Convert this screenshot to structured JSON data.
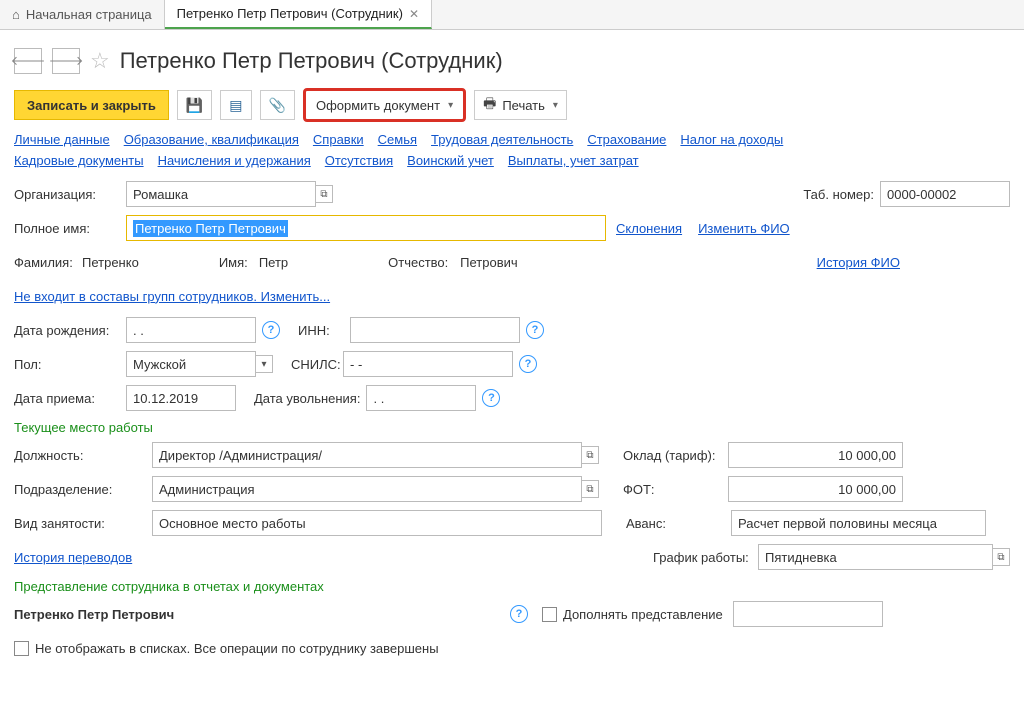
{
  "tabs": {
    "home": "Начальная страница",
    "current": "Петренко Петр Петрович (Сотрудник)"
  },
  "title": "Петренко Петр Петрович (Сотрудник)",
  "toolbar": {
    "save_close": "Записать и закрыть",
    "create_doc": "Оформить документ",
    "print": "Печать"
  },
  "nav1": {
    "personal": "Личные данные",
    "education": "Образование, квалификация",
    "references": "Справки",
    "family": "Семья",
    "labor": "Трудовая деятельность",
    "insurance": "Страхование",
    "taxes": "Налог на доходы"
  },
  "nav2": {
    "hr_docs": "Кадровые документы",
    "accruals": "Начисления и удержания",
    "absences": "Отсутствия",
    "military": "Воинский учет",
    "payments": "Выплаты, учет затрат"
  },
  "labels": {
    "org": "Организация:",
    "tab_num": "Таб. номер:",
    "full_name": "Полное имя:",
    "declensions": "Склонения",
    "change_fio": "Изменить ФИО",
    "surname": "Фамилия:",
    "name": "Имя:",
    "patronymic": "Отчество:",
    "history_fio": "История ФИО",
    "groups": "Не входит в составы групп сотрудников. Изменить...",
    "dob": "Дата рождения:",
    "inn": "ИНН:",
    "sex": "Пол:",
    "snils": "СНИЛС:",
    "hire_date": "Дата приема:",
    "fire_date": "Дата увольнения:",
    "section_work": "Текущее место работы",
    "position": "Должность:",
    "salary": "Оклад (тариф):",
    "department": "Подразделение:",
    "fot": "ФОТ:",
    "employment": "Вид занятости:",
    "advance": "Аванс:",
    "history_transfers": "История переводов",
    "schedule": "График работы:",
    "section_repr": "Представление сотрудника в отчетах и документах",
    "add_repr": "Дополнять представление",
    "hide": "Не отображать в списках. Все операции по сотруднику завершены"
  },
  "values": {
    "org": "Ромашка",
    "tab_num": "0000-00002",
    "full_name": "Петренко Петр Петрович",
    "surname": "Петренко",
    "name": "Петр",
    "patronymic": "Петрович",
    "dob": " .  .",
    "sex": "Мужской",
    "snils": "-   -",
    "hire_date": "10.12.2019",
    "fire_date": " .  .",
    "position": "Директор /Администрация/",
    "salary": "10 000,00",
    "department": "Администрация",
    "fot": "10 000,00",
    "employment": "Основное место работы",
    "advance": "Расчет первой половины месяца",
    "schedule": "Пятидневка",
    "repr_name": "Петренко Петр Петрович"
  }
}
